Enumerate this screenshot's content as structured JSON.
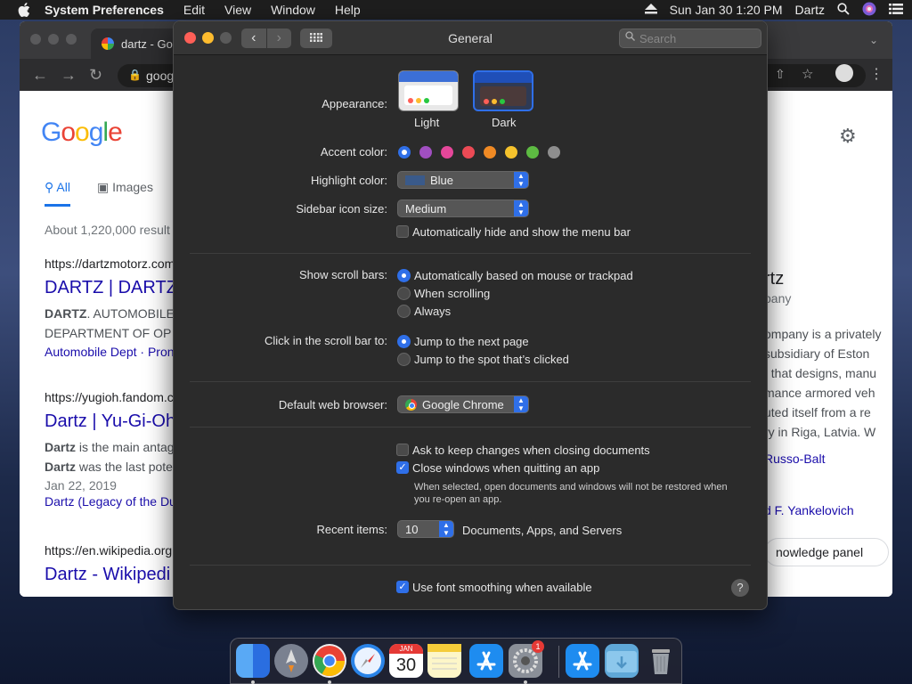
{
  "menubar": {
    "app_name": "System Preferences",
    "items": [
      "Edit",
      "View",
      "Window",
      "Help"
    ],
    "clock": "Sun Jan 30  1:20 PM",
    "user": "Dartz"
  },
  "browser": {
    "tab_title": "dartz - Go",
    "address": "goog",
    "google": {
      "logo_letters": [
        "G",
        "o",
        "o",
        "g",
        "l",
        "e"
      ],
      "tabs": [
        "All",
        "Images"
      ],
      "result_stats": "About 1,220,000 result",
      "results": [
        {
          "url": "https://dartzmotorz.com",
          "title": "DARTZ | DARTZ",
          "snippet1_bold": "DARTZ",
          "snippet1": ". AUTOMOBILE",
          "snippet2": "DEPARTMENT OF OP",
          "links": "Automobile Dept · Pron"
        },
        {
          "url": "https://yugioh.fandom.c",
          "title": "Dartz | Yu-Gi-Oh",
          "snippet1_bold": "Dartz",
          "snippet1": " is the main antag",
          "snippet2_bold": "Dartz",
          "snippet2": " was the last pote",
          "date": "Jan 22, 2019",
          "links": "Dartz (Legacy of the Du"
        },
        {
          "url": "https://en.wikipedia.org",
          "title": "Dartz - Wikipedi"
        }
      ],
      "knowledge_panel": {
        "title": "rtz",
        "subtitle": "pany",
        "lines": [
          "ompany is a privately",
          "subsidiary of Eston",
          ", that designs, manu",
          "mance armored veh",
          "uted itself from a re",
          "ry in Riga, Latvia. W"
        ],
        "link1": "Russo-Balt",
        "link2": "d F. Yankelovich",
        "button": "nowledge panel"
      },
      "side_text": "m"
    }
  },
  "prefs": {
    "title": "General",
    "search_placeholder": "Search",
    "appearance": {
      "label": "Appearance:",
      "options": [
        "Light",
        "Dark"
      ],
      "selected": "Dark"
    },
    "accent": {
      "label": "Accent color:",
      "colors": [
        "#2f6fe8",
        "#a14fc1",
        "#e5479a",
        "#ec4a55",
        "#f08a24",
        "#f5c22c",
        "#5dbb42",
        "#8e8e8e"
      ],
      "selected_index": 0
    },
    "highlight": {
      "label": "Highlight color:",
      "value": "Blue"
    },
    "sidebar_icon": {
      "label": "Sidebar icon size:",
      "value": "Medium"
    },
    "menu_bar": {
      "label": "Automatically hide and show the menu bar",
      "checked": false
    },
    "scroll_bars": {
      "label": "Show scroll bars:",
      "options": [
        "Automatically based on mouse or trackpad",
        "When scrolling",
        "Always"
      ],
      "selected_index": 0
    },
    "click_scroll": {
      "label": "Click in the scroll bar to:",
      "options": [
        "Jump to the next page",
        "Jump to the spot that’s clicked"
      ],
      "selected_index": 0
    },
    "default_browser": {
      "label": "Default web browser:",
      "value": "Google Chrome"
    },
    "ask_keep": {
      "label": "Ask to keep changes when closing documents",
      "checked": false
    },
    "close_windows": {
      "label": "Close windows when quitting an app",
      "checked": true
    },
    "close_note": "When selected, open documents and windows will not be restored when you re-open an app.",
    "recent_items": {
      "label": "Recent items:",
      "value": "10",
      "suffix": "Documents, Apps, and Servers"
    },
    "font_smoothing": {
      "label": "Use font smoothing when available",
      "checked": true
    },
    "help": "?"
  },
  "dock": {
    "apps": [
      "Finder",
      "Launchpad",
      "Chrome",
      "Safari",
      "Calendar",
      "Notes",
      "App Store",
      "System Preferences",
      "App Store",
      "Downloads",
      "Trash"
    ],
    "calendar_month": "JAN",
    "calendar_day": "30",
    "badge": "1"
  }
}
